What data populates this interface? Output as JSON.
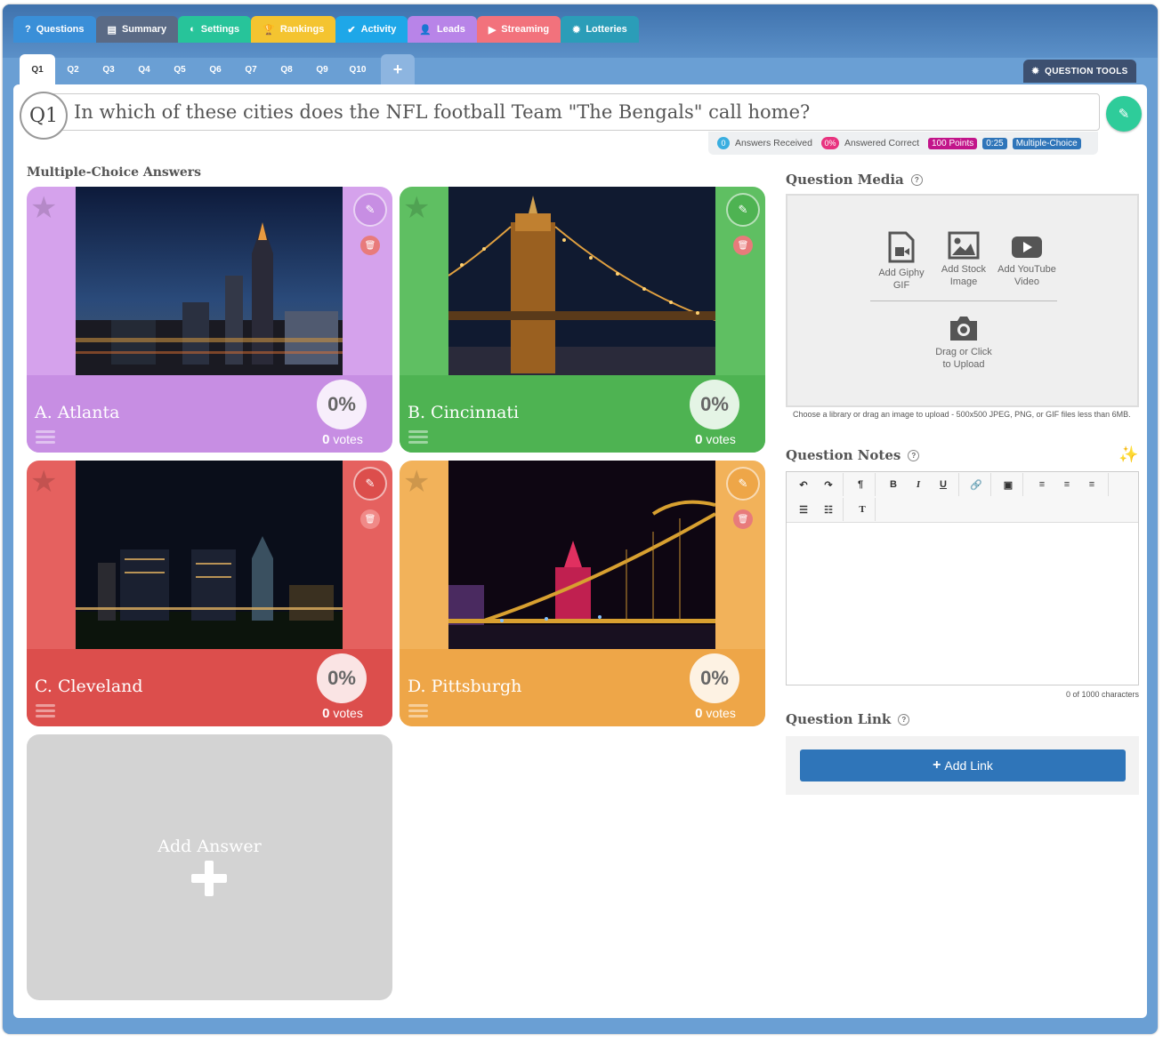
{
  "tabs": [
    {
      "label": "Questions",
      "icon": "question-icon",
      "color": "#3a8fd8"
    },
    {
      "label": "Summary",
      "icon": "summary-icon",
      "color": "#5a6a85"
    },
    {
      "label": "Settings",
      "icon": "toggle-icon",
      "color": "#27c49a"
    },
    {
      "label": "Rankings",
      "icon": "trophy-icon",
      "color": "#f4c430"
    },
    {
      "label": "Activity",
      "icon": "check-circle-icon",
      "color": "#1ea7e8"
    },
    {
      "label": "Leads",
      "icon": "user-icon",
      "color": "#b884e8"
    },
    {
      "label": "Streaming",
      "icon": "video-icon",
      "color": "#f2727c"
    },
    {
      "label": "Lotteries",
      "icon": "gear-icon",
      "color": "#2b9db8"
    }
  ],
  "question_tabs": [
    "Q1",
    "Q2",
    "Q3",
    "Q4",
    "Q5",
    "Q6",
    "Q7",
    "Q8",
    "Q9",
    "Q10"
  ],
  "question_tools_label": "QUESTION TOOLS",
  "question": {
    "number": "Q1",
    "text": "In which of these cities does the NFL football Team \"The Bengals\" call home?"
  },
  "stats": {
    "answers_received_count": "0",
    "answers_received_label": "Answers Received",
    "answered_correct_pct": "0%",
    "answered_correct_label": "Answered Correct",
    "points": "100 Points",
    "time": "0:25",
    "type": "Multiple-Choice"
  },
  "answers_heading": "Multiple-Choice Answers",
  "answers": [
    {
      "label": "A. Atlanta",
      "pct": "0%",
      "votes": "0",
      "votes_label": "votes",
      "color": "#d5a2ec",
      "dark": "#c78ee3",
      "del": "#e87b7b"
    },
    {
      "label": "B. Cincinnati",
      "pct": "0%",
      "votes": "0",
      "votes_label": "votes",
      "color": "#5fbf62",
      "dark": "#4eb352",
      "del": "#e87b7b"
    },
    {
      "label": "C. Cleveland",
      "pct": "0%",
      "votes": "0",
      "votes_label": "votes",
      "color": "#e5615f",
      "dark": "#dc4e4c",
      "del": "#f08a88"
    },
    {
      "label": "D. Pittsburgh",
      "pct": "0%",
      "votes": "0",
      "votes_label": "votes",
      "color": "#f2b25a",
      "dark": "#eea648",
      "del": "#e87b7b"
    }
  ],
  "add_answer_label": "Add Answer",
  "media": {
    "heading": "Question Media",
    "giphy": "Add Giphy\nGIF",
    "stock": "Add Stock\nImage",
    "youtube": "Add YouTube\nVideo",
    "upload": "Drag or Click\nto Upload",
    "note": "Choose a library or drag an image to upload - 500x500 JPEG, PNG, or GIF files less than 6MB."
  },
  "notes": {
    "heading": "Question Notes",
    "chars": "0 of 1000 characters"
  },
  "link": {
    "heading": "Question Link",
    "button": "Add Link"
  }
}
